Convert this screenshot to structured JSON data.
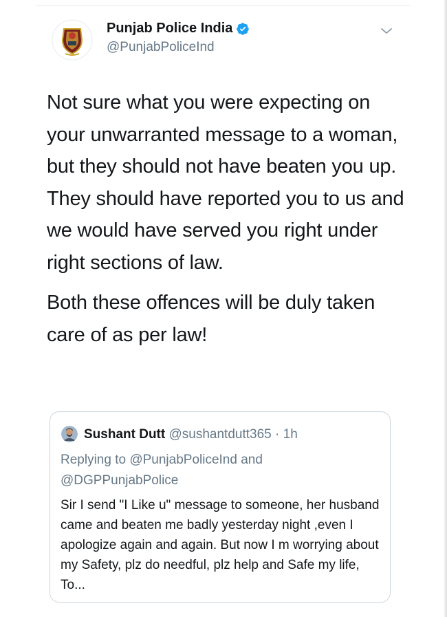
{
  "tweet": {
    "author_name": "Punjab Police India",
    "author_handle": "@PunjabPoliceInd",
    "verified": true,
    "paragraphs": [
      "Not sure what you were expecting on your unwarranted message to a woman, but they should not have beaten you up. They should have reported you to us and we would have served you right under right sections of law.",
      "Both these offences will be duly taken care of as per law!"
    ]
  },
  "quoted": {
    "author_name": "Sushant Dutt",
    "author_handle": "@sushantdutt365",
    "separator": "·",
    "time": "1h",
    "replying_to": "Replying to @PunjabPoliceInd and @DGPPunjabPolice",
    "text": "Sir I send \"I Like u\" message to someone, her husband came and beaten me badly yesterday night ,even I apologize again and again. But now I m worrying about my Safety, plz do needful, plz help and Safe my life, To..."
  },
  "colors": {
    "primary_text": "#14171a",
    "secondary_text": "#657786",
    "verified_blue": "#1da1f2",
    "border": "#ccd6dd"
  },
  "icons": {
    "avatar": "police-emblem-avatar",
    "verified": "verified-badge-icon",
    "menu": "chevron-down-icon"
  }
}
